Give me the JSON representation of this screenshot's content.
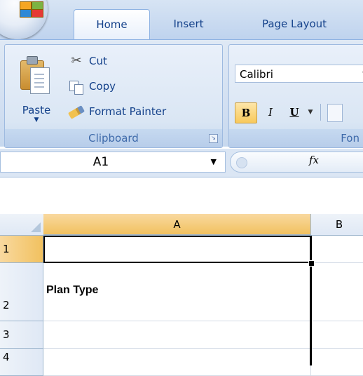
{
  "ribbon": {
    "tabs": [
      {
        "label": "Home",
        "active": true
      },
      {
        "label": "Insert",
        "active": false
      },
      {
        "label": "Page Layout",
        "active": false
      }
    ],
    "clipboard": {
      "paste_label": "Paste",
      "cut_label": "Cut",
      "copy_label": "Copy",
      "format_painter_label": "Format Painter",
      "group_label": "Clipboard"
    },
    "font": {
      "font_name": "Calibri",
      "group_label": "Fon",
      "bold_label": "B",
      "italic_label": "I",
      "underline_label": "U"
    }
  },
  "formula_bar": {
    "cell_reference": "A1",
    "fx_label": "fx"
  },
  "grid": {
    "column_headers": [
      "A",
      "B"
    ],
    "row_headers": [
      "1",
      "2",
      "3",
      "4"
    ],
    "cells": {
      "A1": "",
      "A2": "Plan Type",
      "A3": "",
      "A4": ""
    },
    "selected_cell": "A1"
  },
  "colors": {
    "ribbon_blue": "#dfe9f5",
    "tab_text": "#15428b",
    "selected_header": "#f1c15f",
    "selection_border": "#000000"
  }
}
